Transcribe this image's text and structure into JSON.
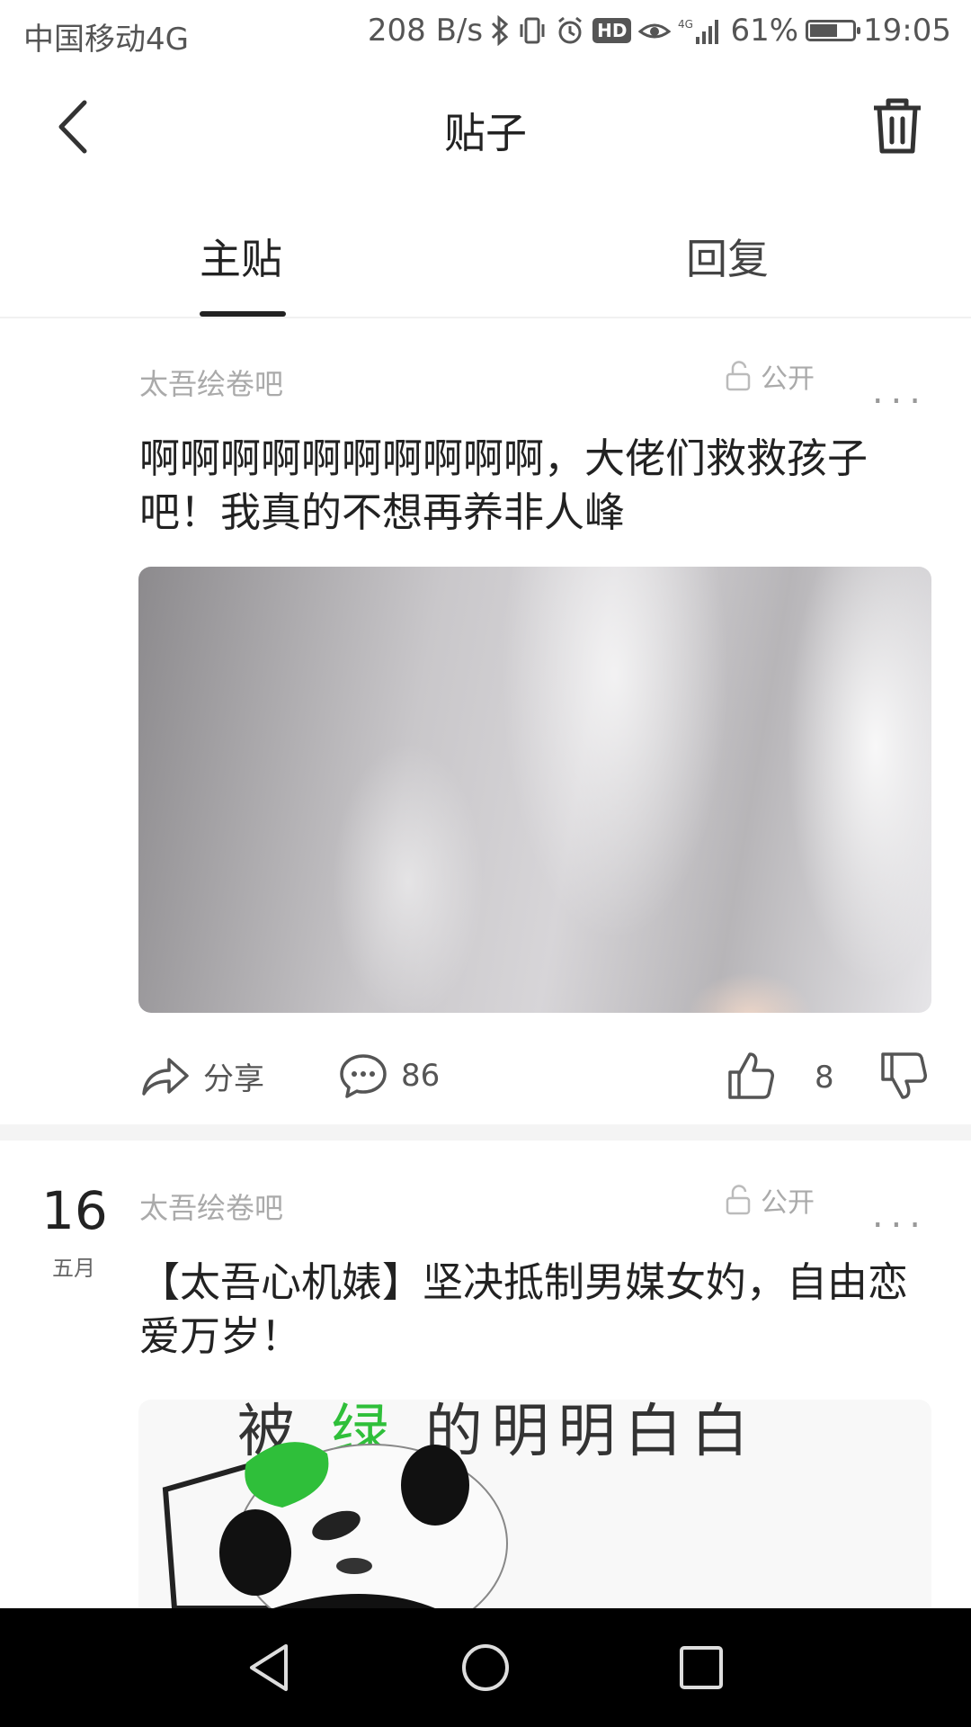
{
  "status_bar": {
    "carrier": "中国移动4G",
    "speed": "208 B/s",
    "signal_label": "4G",
    "battery_percent": "61%",
    "time": "19:05",
    "hd_label": "HD"
  },
  "header": {
    "title": "贴子"
  },
  "tabs": [
    {
      "label": "主贴",
      "active": true
    },
    {
      "label": "回复",
      "active": false
    }
  ],
  "posts": [
    {
      "forum": "太吾绘卷吧",
      "privacy": "公开",
      "more": "...",
      "title": "啊啊啊啊啊啊啊啊啊啊，大佬们救救孩子吧！我真的不想再养非人峰",
      "actions": {
        "share_label": "分享",
        "comment_count": "86",
        "like_count": "8"
      }
    },
    {
      "date_day": "16",
      "date_month": "五月",
      "forum": "太吾绘卷吧",
      "privacy": "公开",
      "more": "...",
      "title": "【太吾心机婊】坚决抵制男媒女妁，自由恋爱万岁！",
      "image_text": {
        "part1": "被",
        "highlight": "绿",
        "part2": "的明明白白"
      }
    }
  ],
  "colors": {
    "accent": "#222222",
    "muted": "#aaaaaa",
    "meme_green": "#2fbf3a",
    "nav_bg": "#000000"
  }
}
